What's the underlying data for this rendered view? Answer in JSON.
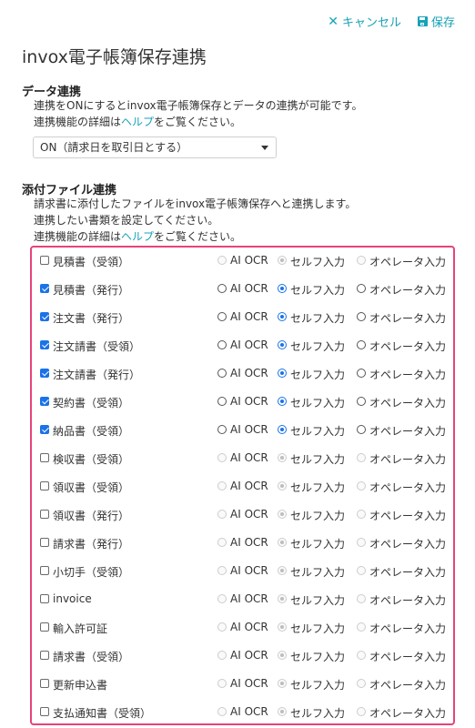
{
  "toolbar": {
    "cancel_label": "キャンセル",
    "save_label": "保存"
  },
  "page_title": "invox電子帳簿保存連携",
  "data_link": {
    "title": "データ連携",
    "desc_line1": "連携をONにするとinvox電子帳簿保存とデータの連携が可能です。",
    "desc_line2_pre": "連携機能の詳細は",
    "desc_line2_link": "ヘルプ",
    "desc_line2_post": "をご覧ください。",
    "select_value": "ON（請求日を取引日とする）"
  },
  "attach": {
    "title": "添付ファイル連携",
    "desc_line1": "請求書に添付したファイルをinvox電子帳簿保存へと連携します。",
    "desc_line2": "連携したい書類を設定してください。",
    "desc_line3_pre": "連携機能の詳細は",
    "desc_line3_link": "ヘルプ",
    "desc_line3_post": "をご覧ください。"
  },
  "radio_labels": {
    "ai_ocr": "AI OCR",
    "self": "セルフ入力",
    "operator": "オペレータ入力"
  },
  "documents": [
    {
      "name": "見積書（受領）",
      "checked": false,
      "mode": "self"
    },
    {
      "name": "見積書（発行）",
      "checked": true,
      "mode": "self"
    },
    {
      "name": "注文書（発行）",
      "checked": true,
      "mode": "self"
    },
    {
      "name": "注文請書（受領）",
      "checked": true,
      "mode": "self"
    },
    {
      "name": "注文請書（発行）",
      "checked": true,
      "mode": "self"
    },
    {
      "name": "契約書（受領）",
      "checked": true,
      "mode": "self"
    },
    {
      "name": "納品書（受領）",
      "checked": true,
      "mode": "self"
    },
    {
      "name": "検収書（受領）",
      "checked": false,
      "mode": "self"
    },
    {
      "name": "領収書（受領）",
      "checked": false,
      "mode": "self"
    },
    {
      "name": "領収書（発行）",
      "checked": false,
      "mode": "self"
    },
    {
      "name": "請求書（発行）",
      "checked": false,
      "mode": "self"
    },
    {
      "name": "小切手（受領）",
      "checked": false,
      "mode": "self"
    },
    {
      "name": "invoice",
      "checked": false,
      "mode": "self"
    },
    {
      "name": "輸入許可証",
      "checked": false,
      "mode": "self"
    },
    {
      "name": "請求書（受領）",
      "checked": false,
      "mode": "self"
    },
    {
      "name": "更新申込書",
      "checked": false,
      "mode": "self"
    },
    {
      "name": "支払通知書（受領）",
      "checked": false,
      "mode": "self"
    }
  ]
}
